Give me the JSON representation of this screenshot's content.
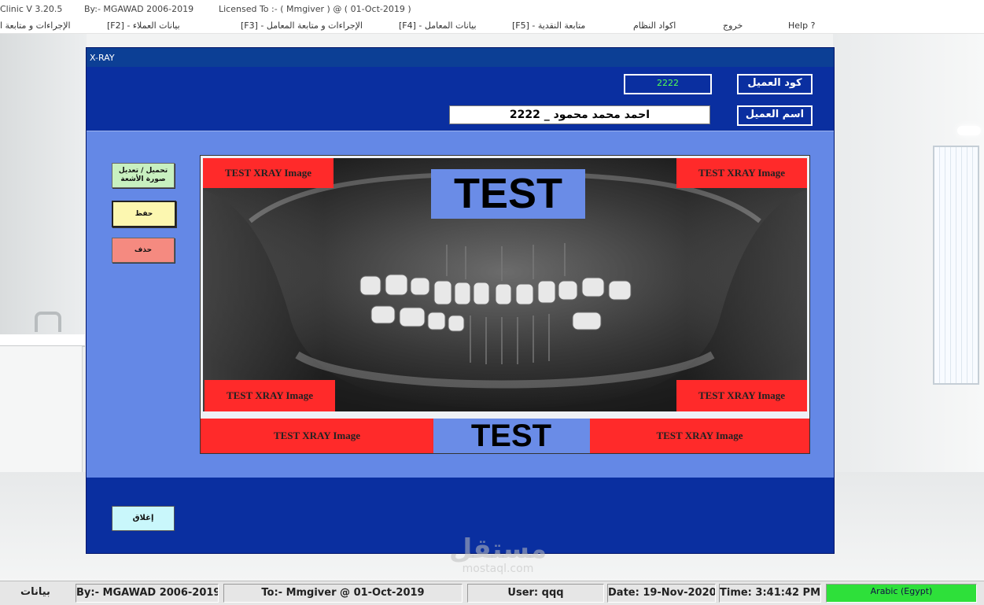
{
  "titlebar": {
    "app": "Clinic V 3.20.5",
    "author": "By:- MGAWAD 2006-2019",
    "license": "Licensed To :- ( Mmgiver ) @ ( 01-Oct-2019 )"
  },
  "menu": {
    "procedures_partial": "الإجراءات و متابعة ا",
    "clients": "[F2] - بيانات العملاء",
    "lab_procedures": "[F3] - الإجراءات و متابعة المعامل",
    "labs": "[F4] - بيانات المعامل",
    "cash": "[F5] - متابعة النقدية",
    "codes": "اكواد النظام",
    "exit": "خروج",
    "help": "Help ?"
  },
  "window": {
    "title": "X-RAY",
    "client_code_label": "كود العميل",
    "client_code_value": "2222",
    "client_name_label": "اسم العميل",
    "client_name_value": "احمد محمد محمود _ 2222",
    "buttons": {
      "load": "تحميل / تعديل صورة الأشعة",
      "save": "حفظ",
      "delete": "حذف",
      "close": "إغلاق"
    },
    "xray": {
      "tag_tl": "TEST XRAY Image",
      "tag_tr": "TEST XRAY Image",
      "tag_bl": "TEST XRAY Image",
      "tag_br": "TEST XRAY Image",
      "test_top": "TEST",
      "strip_left": "TEST XRAY Image",
      "test_bottom": "TEST",
      "strip_right": "TEST XRAY Image"
    }
  },
  "statusbar": {
    "data": "بيانات",
    "author": "By:- MGAWAD 2006-2019",
    "to": "To:- Mmgiver @ 01-Oct-2019",
    "user": "User: qqq",
    "date": "Date: 19-Nov-2020",
    "time": "Time: 3:41:42 PM",
    "language": "Arabic (Egypt)"
  },
  "watermark": {
    "logo": "مستقل",
    "site": "mostaql.com"
  },
  "colors": {
    "window_blue": "#0a2fa0",
    "panel_blue": "#6488e6",
    "tag_red": "#ff2a2a",
    "code_green": "#52ff52",
    "save_yellow": "#fcf7b0",
    "delete_red": "#f58a80",
    "load_green": "#c8f0c0",
    "close_cyan": "#c9f7fb",
    "language_green": "#2ee03a"
  }
}
